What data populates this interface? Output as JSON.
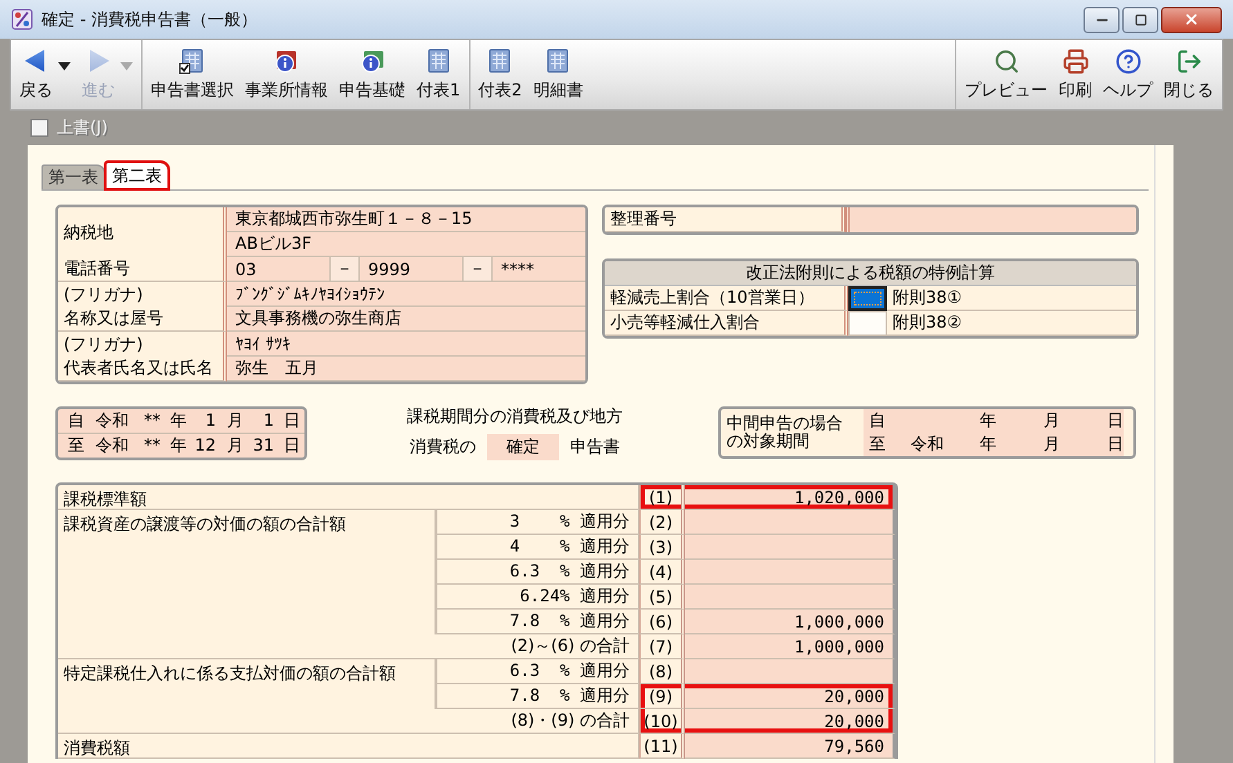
{
  "window": {
    "title": "確定 - 消費税申告書（一般）"
  },
  "toolbar": {
    "navigation": [
      {
        "label": "戻る",
        "disabled": false
      },
      {
        "label": "進む",
        "disabled": true
      }
    ],
    "forms": [
      [
        {
          "label": "申告書選択"
        },
        {
          "label": "事業所情報"
        },
        {
          "label": "申告基礎"
        },
        {
          "label": "付表1"
        }
      ],
      [
        {
          "label": "付表2"
        },
        {
          "label": "明細書"
        }
      ]
    ],
    "actions": [
      {
        "label": "プレビュー"
      },
      {
        "label": "印刷"
      },
      {
        "label": "ヘルプ"
      },
      {
        "label": "閉じる"
      }
    ]
  },
  "overwrite": {
    "label": "上書(J)",
    "checked": false,
    "disabled": true
  },
  "tabs": [
    {
      "label": "第一表",
      "selected": false,
      "highlighted": false
    },
    {
      "label": "第二表",
      "selected": true,
      "highlighted": true
    }
  ],
  "taxpayer": {
    "address_label": "納税地",
    "address_lines": [
      "東京都城西市弥生町１－８－15",
      "ABビル3F"
    ],
    "phone_label": "電話番号",
    "phone_parts": [
      "03",
      "9999",
      "****"
    ],
    "phone_separators": [
      "－",
      "－"
    ],
    "names": [
      {
        "furigana_label": "(フリガナ)",
        "furigana": "ﾌﾞﾝｸﾞｼﾞﾑｷﾉﾔﾖｲｼｮｳﾃﾝ",
        "label": "名称又は屋号",
        "value": "文具事務機の弥生商店"
      },
      {
        "furigana_label": "(フリガナ)",
        "furigana": "ﾔﾖｲ ｻﾂｷ",
        "label": "代表者氏名又は氏名",
        "value": "弥生　五月"
      }
    ]
  },
  "reference": {
    "label": "整理番号"
  },
  "special_calc": {
    "title": "改正法附則による税額の特例計算",
    "rows": [
      {
        "label": "軽減売上割合（10営業日）",
        "checked": true,
        "note": "附則38①"
      },
      {
        "label": "小売等軽減仕入割合",
        "checked": false,
        "note": "附則38②"
      }
    ]
  },
  "period": [
    {
      "parts": [
        "自",
        "令和",
        "**",
        "年",
        "1",
        "月",
        "1",
        "日"
      ]
    },
    {
      "parts": [
        "至",
        "令和",
        "**",
        "年",
        "12",
        "月",
        "31",
        "日"
      ]
    }
  ],
  "declaration": {
    "heading": "課税期間分の消費税及び地方",
    "prefix": "消費税の",
    "type": "確定",
    "suffix": "申告書"
  },
  "interim": {
    "label_lines": [
      "中間申告の場合",
      "の対象期間"
    ],
    "rows": [
      {
        "prefix": "自",
        "units": [
          "年",
          "月",
          "日"
        ]
      },
      {
        "prefix": "至",
        "era": "令和",
        "units": [
          "年",
          "月",
          "日"
        ]
      }
    ]
  },
  "tax_table": {
    "groups": [
      {
        "label": "課税標準額",
        "rows": [
          {
            "no": "(1)",
            "value": "1,020,000",
            "highlighted": true
          }
        ]
      },
      {
        "label": "課税資産の譲渡等の対価の額の合計額",
        "rows": [
          {
            "kind": "rate",
            "rate": "3    % 適用分",
            "no": "(2)",
            "highlighted": false
          },
          {
            "kind": "rate",
            "rate": "4    % 適用分",
            "no": "(3)",
            "highlighted": false
          },
          {
            "kind": "rate",
            "rate": "6.3  % 適用分",
            "no": "(4)",
            "highlighted": false
          },
          {
            "kind": "rate",
            "rate": "6.24% 適用分",
            "no": "(5)",
            "highlighted": false
          },
          {
            "kind": "rate",
            "rate": "7.8  % 適用分",
            "no": "(6)",
            "value": "1,000,000",
            "highlighted": false
          },
          {
            "kind": "total",
            "rate": "(2)～(6) の合計",
            "no": "(7)",
            "value": "1,000,000",
            "highlighted": false
          }
        ]
      },
      {
        "label": "特定課税仕入れに係る支払対価の額の合計額",
        "rows": [
          {
            "kind": "rate",
            "rate": "6.3  % 適用分",
            "no": "(8)",
            "highlighted": false
          },
          {
            "kind": "rate",
            "rate": "7.8  % 適用分",
            "no": "(9)",
            "value": "20,000",
            "highlighted": true
          },
          {
            "kind": "total",
            "rate": "(8)・(9) の合計",
            "no": "(10)",
            "value": "20,000",
            "highlighted": true
          }
        ]
      },
      {
        "label": "消費税額",
        "rows": [
          {
            "no": "(11)",
            "value": "79,560",
            "highlighted": false
          }
        ]
      }
    ]
  }
}
